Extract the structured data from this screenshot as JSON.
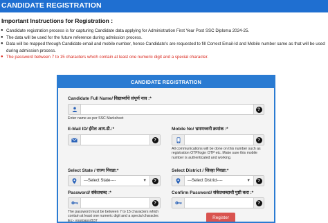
{
  "header": {
    "title": "CANDIDATE REGISTRATION"
  },
  "instructions": {
    "title": "Important Instructions for Registration :",
    "items": [
      "Candidate registration process is for capturing Candidate data applying for Administration First Year Post SSC Diploma 2024-25.",
      "The data will be used for the future reference during admission process.",
      "Data will be mapped through Candidate email and mobile number, hence Candidate's are requested to fill Correct Email-Id and Mobile number same as that will be used during admission process.",
      "The password between 7 to 15 characters which contain at least one numeric digit and a special character."
    ]
  },
  "form": {
    "title": "CANDIDATE REGISTRATION",
    "full_name": {
      "label": "Candidate Full Name/ विद्यार्थ्याचे संपूर्ण नाव :*",
      "value": "",
      "hint": "Enter name as per SSC Marksheet"
    },
    "email": {
      "label": "E-Mail ID/ ईमेल आय.डी.:*",
      "value": ""
    },
    "mobile": {
      "label": "Mobile No/ भ्रमणध्वनी क्रमांक :*",
      "value": "",
      "hint": "All communications will be done on this number such as registration OTP/login OTP etc. Make sure this mobile number is authenticated and working."
    },
    "state": {
      "label": "Select State / राज्य निवडा:*",
      "selected": "---Select State----"
    },
    "district": {
      "label": "Select District / जिल्हा निवडा:*",
      "selected": "---Select District----"
    },
    "password": {
      "label": "Password/ संकेतशब्द :*",
      "value": "",
      "hint": "The password must be between 7 to 15 characters which contain at least one numeric digit and a special character. Ex:- yourpass@37"
    },
    "confirm_password": {
      "label": "Confirm Password/ संकेतशब्दाची पुष्टी करा :*",
      "value": ""
    },
    "register_label": "Register",
    "help_glyph": "?"
  },
  "icons": {
    "user": "user-icon",
    "email": "envelope-icon",
    "mobile": "mobile-phone-icon",
    "location": "map-marker-icon",
    "password": "key-icon",
    "help": "question-circle-icon"
  },
  "colors": {
    "header_blue": "#1f6fd1",
    "form_border": "#2a7bd2",
    "warning_red": "#d9261c",
    "register_button": "#d9534f",
    "icon_blue": "#2a62b8"
  }
}
